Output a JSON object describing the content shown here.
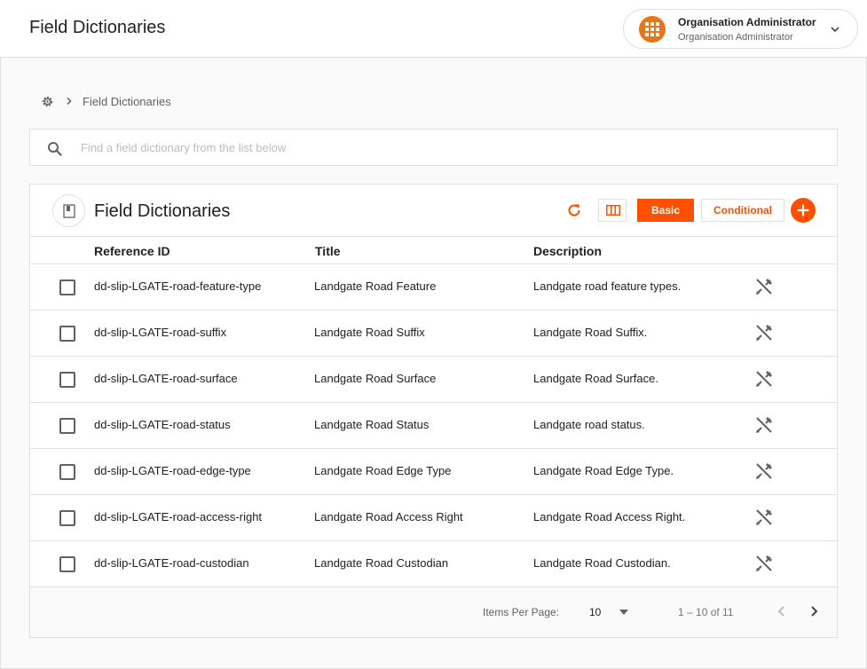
{
  "app": {
    "title": "Field Dictionaries"
  },
  "user": {
    "name": "Organisation Administrator",
    "role": "Organisation Administrator"
  },
  "breadcrumb": {
    "current": "Field Dictionaries"
  },
  "search": {
    "placeholder": "Find a field dictionary from the list below",
    "value": ""
  },
  "card": {
    "title": "Field Dictionaries",
    "basic_label": "Basic",
    "conditional_label": "Conditional"
  },
  "table": {
    "columns": [
      "Reference ID",
      "Title",
      "Description"
    ],
    "rows": [
      {
        "ref": "dd-slip-LGATE-road-feature-type",
        "title": "Landgate Road Feature",
        "description": "Landgate road feature types."
      },
      {
        "ref": "dd-slip-LGATE-road-suffix",
        "title": "Landgate Road Suffix",
        "description": "Landgate Road Suffix."
      },
      {
        "ref": "dd-slip-LGATE-road-surface",
        "title": "Landgate Road Surface",
        "description": "Landgate Road Surface."
      },
      {
        "ref": "dd-slip-LGATE-road-status",
        "title": "Landgate Road Status",
        "description": "Landgate road status."
      },
      {
        "ref": "dd-slip-LGATE-road-edge-type",
        "title": "Landgate Road Edge Type",
        "description": "Landgate Road Edge Type."
      },
      {
        "ref": "dd-slip-LGATE-road-access-right",
        "title": "Landgate Road Access Right",
        "description": "Landgate Road Access Right."
      },
      {
        "ref": "dd-slip-LGATE-road-custodian",
        "title": "Landgate Road Custodian",
        "description": "Landgate Road Custodian."
      }
    ]
  },
  "pagination": {
    "items_per_page_label": "Items Per Page:",
    "items_per_page": "10",
    "range": "1 – 10 of 11"
  },
  "icons": {
    "org_logo": "org-logo-icon",
    "chevron": "chevron-down-icon",
    "gear": "gear-icon",
    "breadcrumb_sep": "chevron-right-icon",
    "search": "search-icon",
    "book": "book-icon",
    "refresh": "refresh-icon",
    "columns": "columns-icon",
    "add": "add-icon",
    "edit": "edit-icon",
    "prev": "chevron-left-icon",
    "next": "chevron-right-icon"
  },
  "colors": {
    "accent": "#fe5000",
    "logo": "#e8751a",
    "border": "#e0e0e0",
    "muted": "#616161"
  }
}
